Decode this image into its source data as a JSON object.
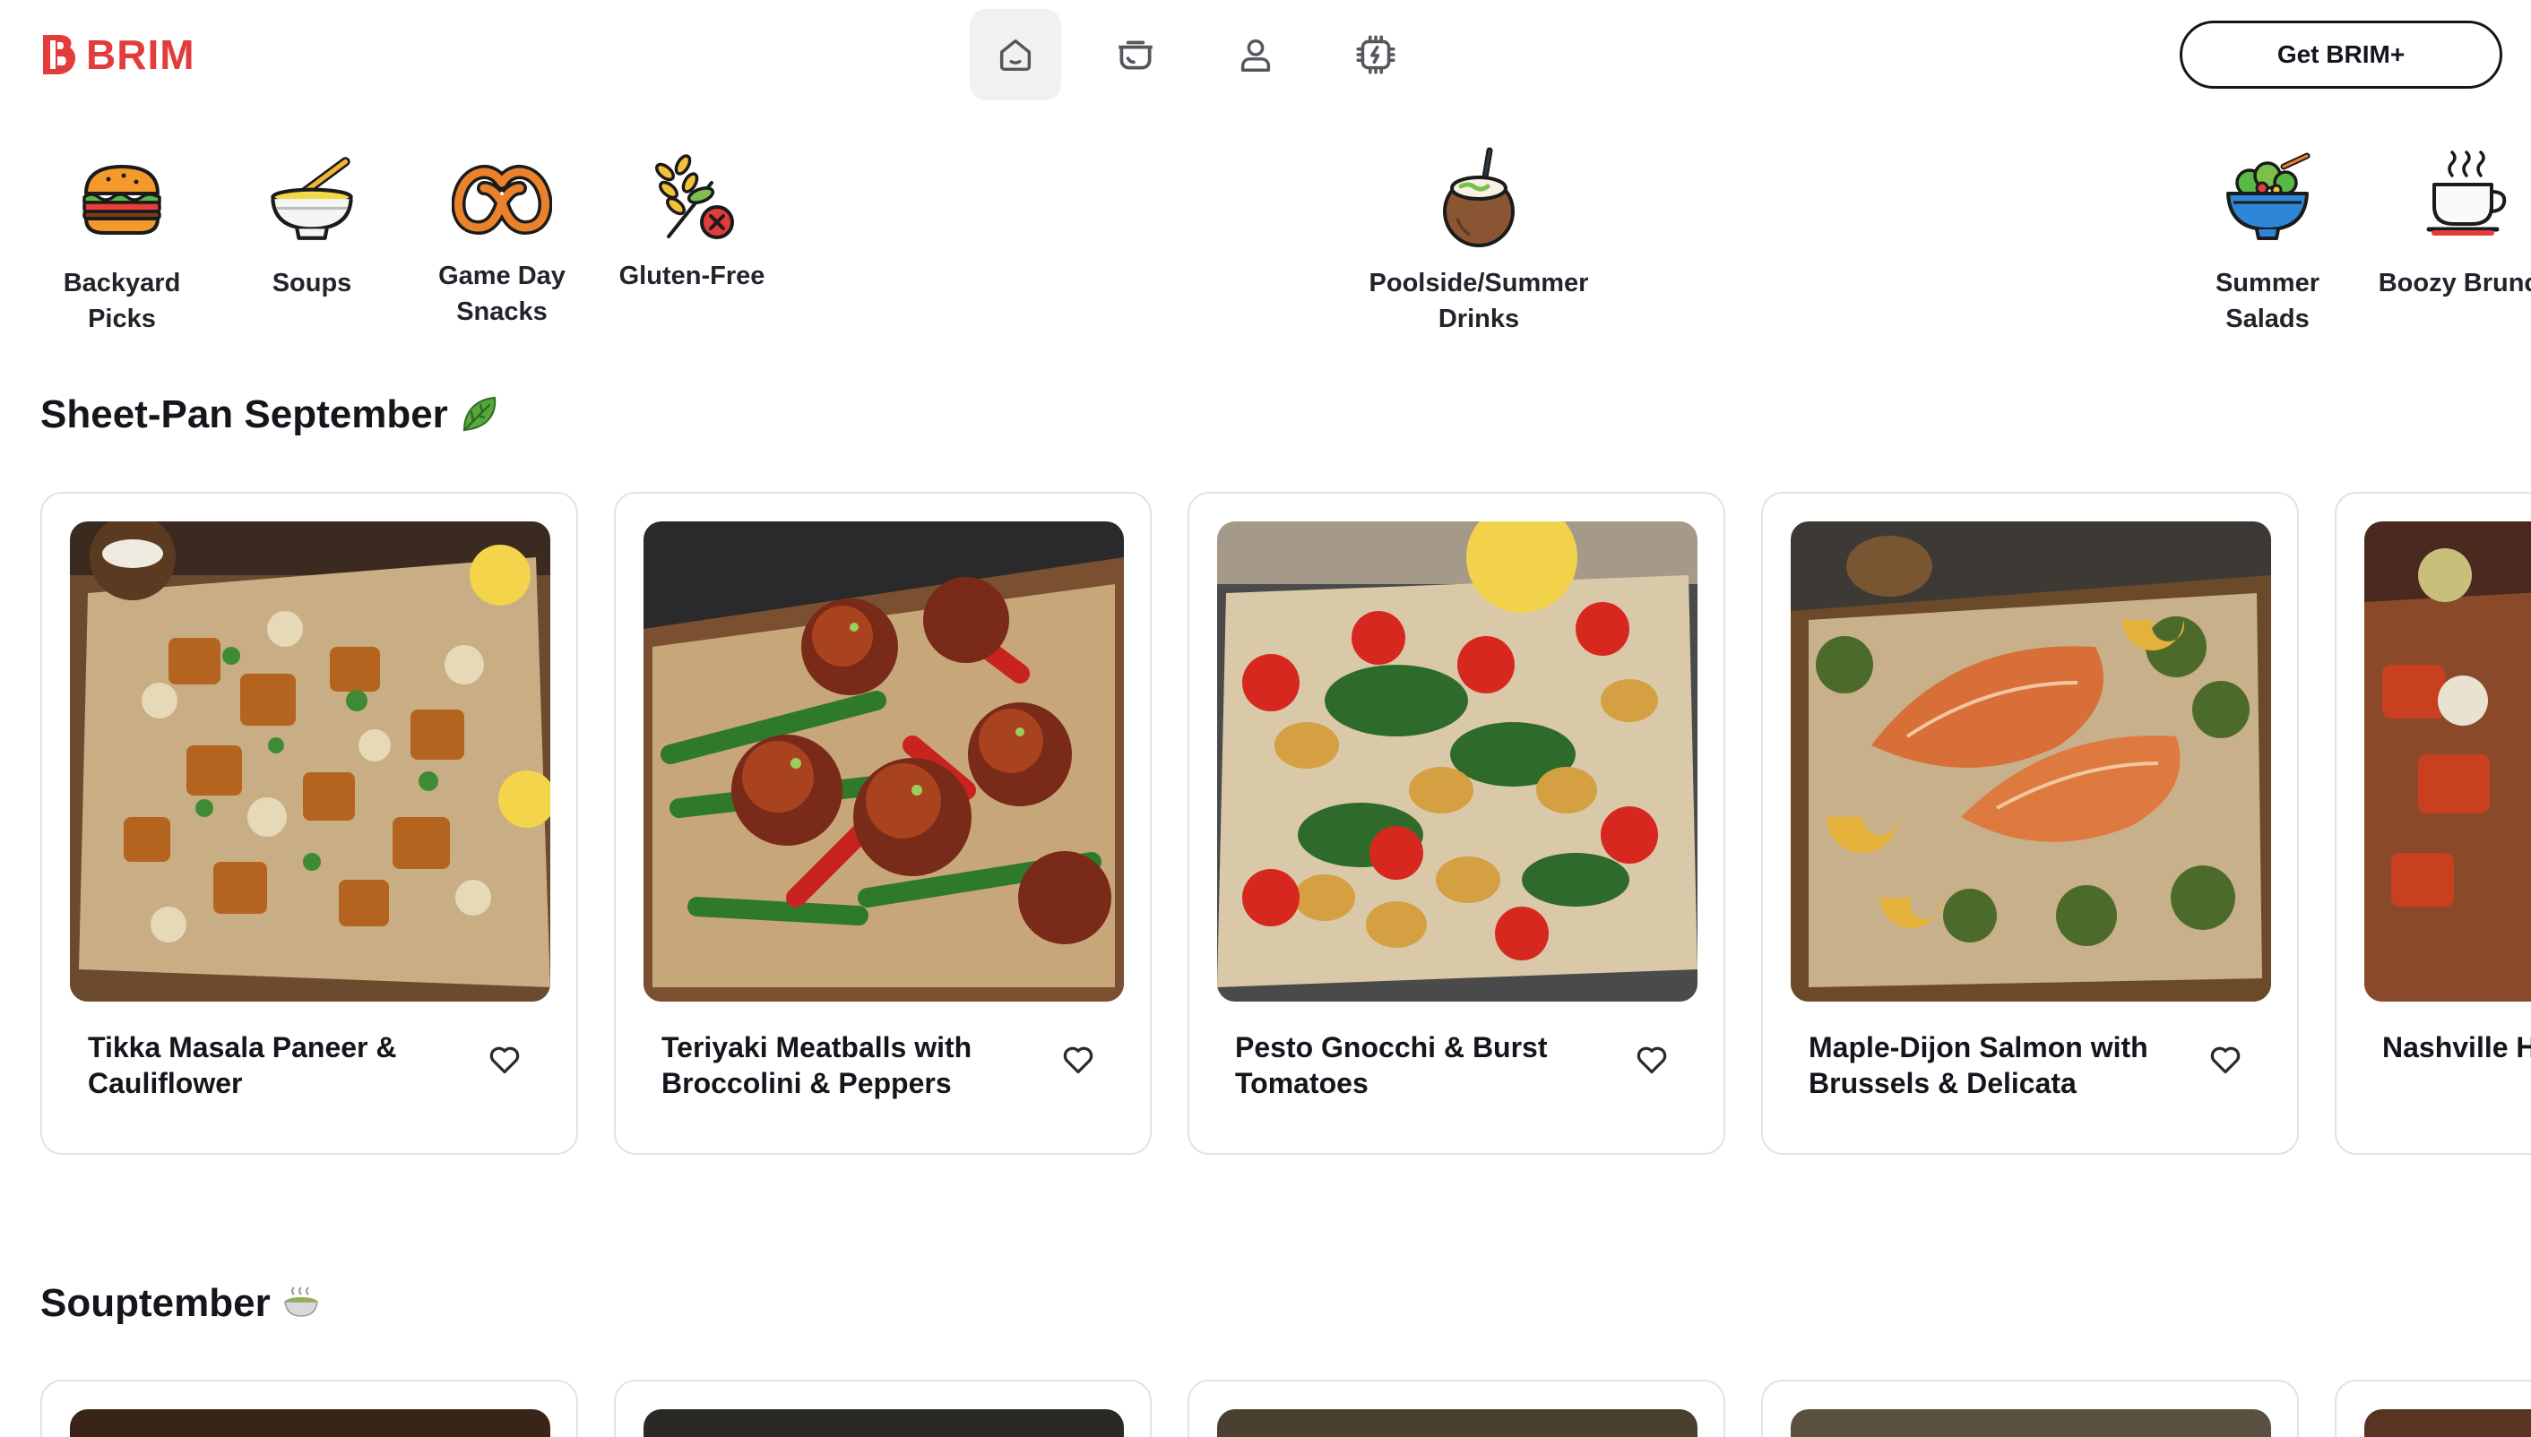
{
  "brand": {
    "name": "BRIM",
    "color": "#e23c3c"
  },
  "nav": {
    "items": [
      {
        "icon": "home-icon",
        "active": true
      },
      {
        "icon": "pot-icon",
        "active": false
      },
      {
        "icon": "user-icon",
        "active": false
      },
      {
        "icon": "chip-icon",
        "active": false
      }
    ]
  },
  "cta": {
    "label": "Get BRIM+"
  },
  "categories": [
    {
      "label": "Backyard Picks",
      "icon": "burger-icon"
    },
    {
      "label": "Soups",
      "icon": "soup-bowl-icon"
    },
    {
      "label": "Game Day\nSnacks",
      "icon": "pretzel-icon"
    },
    {
      "label": "Gluten-Free",
      "icon": "wheat-crossed-icon"
    },
    {
      "label": "Poolside/Summer\nDrinks",
      "icon": "coconut-drink-icon"
    },
    {
      "label": "Summer\nSalads",
      "icon": "salad-bowl-icon"
    },
    {
      "label": "Boozy Brunch",
      "icon": "coffee-cup-icon"
    }
  ],
  "sections": [
    {
      "title": "Sheet-Pan September",
      "emoji_icon": "leafy-green-icon",
      "cards": [
        {
          "title": "Tikka Masala Paneer & Cauliflower"
        },
        {
          "title": "Teriyaki Meatballs with Broccolini & Peppers"
        },
        {
          "title": "Pesto Gnocchi & Burst Tomatoes"
        },
        {
          "title": "Maple-Dijon Salmon with Brussels & Delicata"
        },
        {
          "title": "Nashville Hot Sweet Potato"
        }
      ]
    },
    {
      "title": "Souptember",
      "emoji_icon": "soup-bowl-emoji-icon",
      "cards": [
        {},
        {},
        {},
        {},
        {}
      ]
    }
  ]
}
